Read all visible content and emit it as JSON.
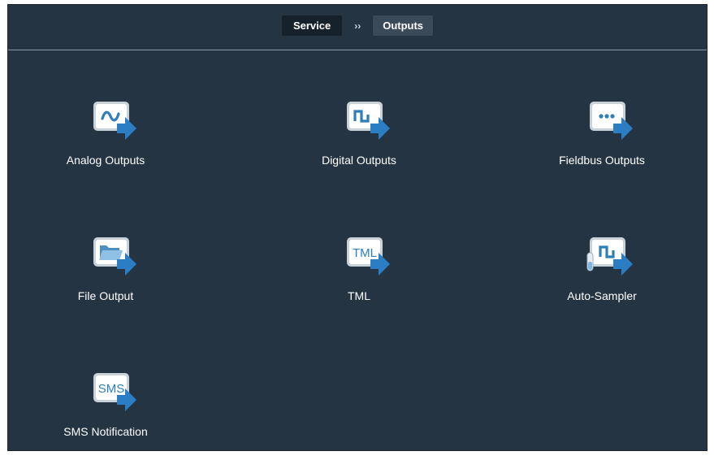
{
  "breadcrumb": {
    "items": [
      "Service",
      "Outputs"
    ],
    "separator": "››"
  },
  "tiles": [
    {
      "label": "Analog Outputs",
      "icon": "analog-wave-icon"
    },
    {
      "label": "Digital Outputs",
      "icon": "digital-square-wave-icon"
    },
    {
      "label": "Fieldbus Outputs",
      "icon": "fieldbus-dots-icon"
    },
    {
      "label": "File Output",
      "icon": "folder-icon"
    },
    {
      "label": "TML",
      "icon": "tml-icon",
      "glyph": "TML"
    },
    {
      "label": "Auto-Sampler",
      "icon": "auto-sampler-icon"
    },
    {
      "label": "SMS Notification",
      "icon": "sms-icon",
      "glyph": "SMS"
    }
  ],
  "colors": {
    "background": "#243442",
    "icon_accent": "#2e7fb9",
    "arrow": "#2c7ec4"
  }
}
